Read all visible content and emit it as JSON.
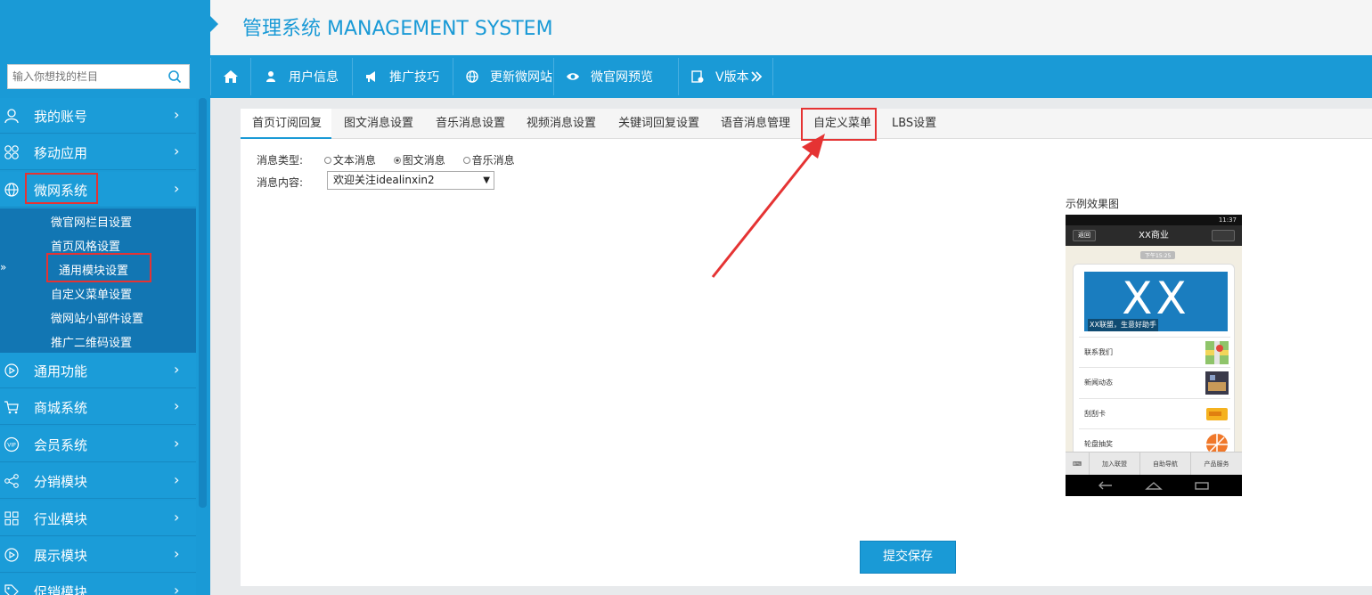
{
  "app": {
    "title": "管理系统 MANAGEMENT SYSTEM"
  },
  "search": {
    "placeholder": "输入你想找的栏目"
  },
  "sidebar": {
    "items": [
      {
        "label": "我的账号",
        "icon": "user-icon"
      },
      {
        "label": "移动应用",
        "icon": "apps-icon"
      },
      {
        "label": "微网系统",
        "icon": "globe-icon"
      },
      {
        "label": "通用功能",
        "icon": "play-icon"
      },
      {
        "label": "商城系统",
        "icon": "cart-icon"
      },
      {
        "label": "会员系统",
        "icon": "vip-icon"
      },
      {
        "label": "分销模块",
        "icon": "share-icon"
      },
      {
        "label": "行业模块",
        "icon": "grid-icon"
      },
      {
        "label": "展示模块",
        "icon": "play-icon"
      },
      {
        "label": "促销模块",
        "icon": "tag-icon"
      }
    ],
    "subitems": [
      "微官网栏目设置",
      "首页风格设置",
      "通用模块设置",
      "自定义菜单设置",
      "微网站小部件设置",
      "推广二维码设置"
    ],
    "chevron": "›",
    "marker": "»"
  },
  "topnav": {
    "items": [
      {
        "label": "用户信息",
        "icon": "user-icon"
      },
      {
        "label": "推广技巧",
        "icon": "megaphone-icon"
      },
      {
        "label": "更新微网站",
        "icon": "globe-icon"
      },
      {
        "label": "微官网预览",
        "icon": "eye-icon"
      },
      {
        "label": "V版本",
        "icon": "version-icon"
      }
    ]
  },
  "tabs": [
    "首页订阅回复",
    "图文消息设置",
    "音乐消息设置",
    "视频消息设置",
    "关键词回复设置",
    "语音消息管理",
    "自定义菜单",
    "LBS设置"
  ],
  "form": {
    "type_label": "消息类型:",
    "options": [
      "文本消息",
      "图文消息",
      "音乐消息"
    ],
    "selected_option": "图文消息",
    "content_label": "消息内容:",
    "content_value": "欢迎关注idealinxin2"
  },
  "preview": {
    "label": "示例效果图",
    "status_time": "11:37",
    "header_title": "XX商业",
    "back": "返回",
    "time_tag": "下午15:25",
    "banner_text": "XX",
    "banner_caption": "XX联盟，生意好助手",
    "rows": [
      "联系我们",
      "新闻动态",
      "刮刮卡",
      "轮盘抽奖"
    ],
    "footer": [
      "加入联盟",
      "自助导航",
      "产品服务"
    ]
  },
  "submit_label": "提交保存",
  "colors": {
    "primary": "#1a9ad6",
    "annotation": "#e53333"
  }
}
